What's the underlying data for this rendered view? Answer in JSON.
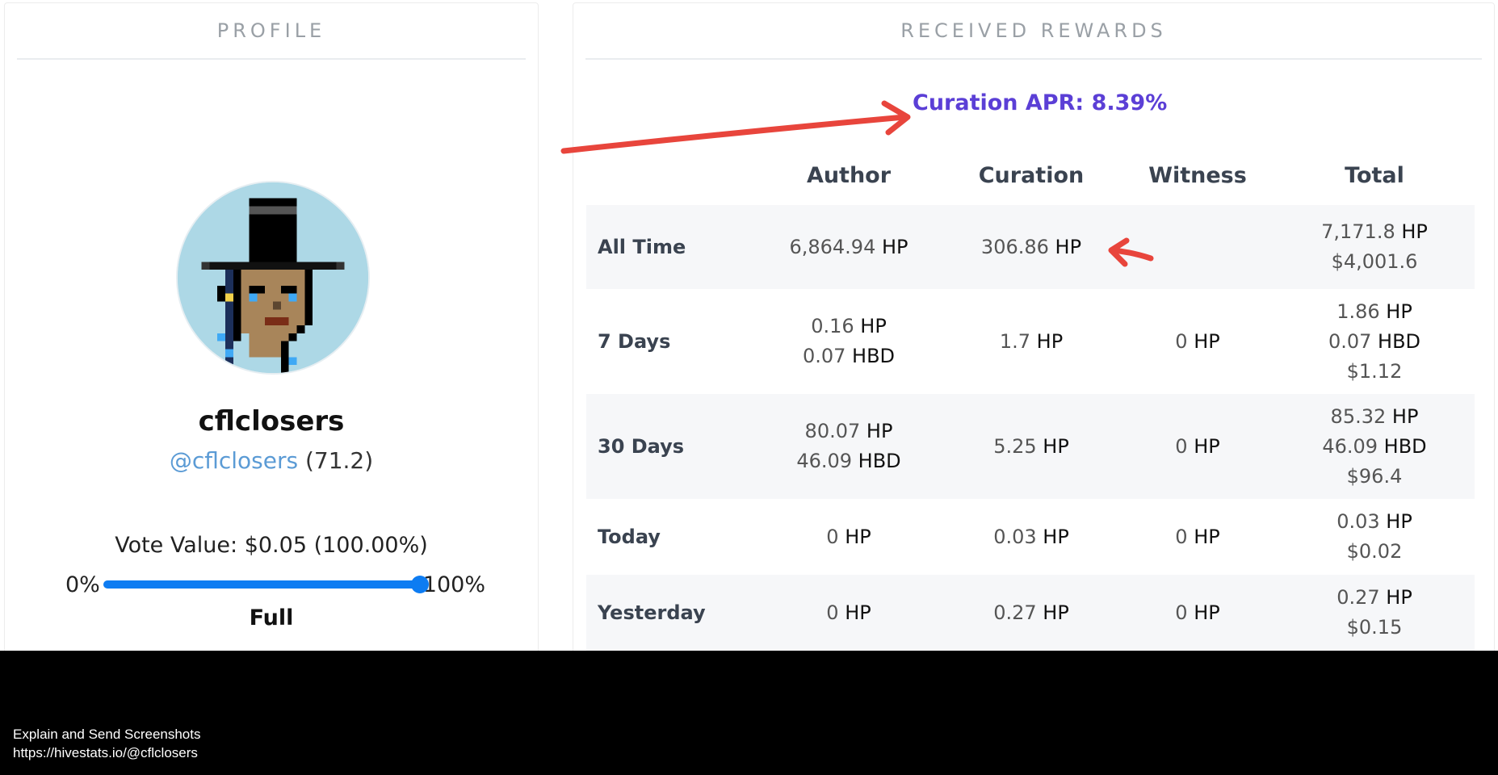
{
  "profile": {
    "header": "PROFILE",
    "username": "cflclosers",
    "handle": "@cflclosers",
    "reputation": "(71.2)",
    "vote_value": "Vote Value: $0.05 (100.00%)",
    "slider": {
      "min_label": "0%",
      "max_label": "100%",
      "level": 1.0
    },
    "vote_state": "Full"
  },
  "rewards": {
    "header": "RECEIVED REWARDS",
    "apr": "Curation APR: 8.39%",
    "columns": [
      "",
      "Author",
      "Curation",
      "Witness",
      "Total"
    ],
    "rows": [
      {
        "label": "All Time",
        "author": [
          {
            "v": "6,864.94",
            "u": "HP"
          }
        ],
        "curation": [
          {
            "v": "306.86",
            "u": "HP"
          }
        ],
        "witness": [],
        "total": [
          {
            "v": "7,171.8",
            "u": "HP"
          },
          {
            "v": "$4,001.6",
            "u": ""
          }
        ]
      },
      {
        "label": "7 Days",
        "author": [
          {
            "v": "0.16",
            "u": "HP"
          },
          {
            "v": "0.07",
            "u": "HBD"
          }
        ],
        "curation": [
          {
            "v": "1.7",
            "u": "HP"
          }
        ],
        "witness": [
          {
            "v": "0",
            "u": "HP"
          }
        ],
        "total": [
          {
            "v": "1.86",
            "u": "HP"
          },
          {
            "v": "0.07",
            "u": "HBD"
          },
          {
            "v": "$1.12",
            "u": ""
          }
        ]
      },
      {
        "label": "30 Days",
        "author": [
          {
            "v": "80.07",
            "u": "HP"
          },
          {
            "v": "46.09",
            "u": "HBD"
          }
        ],
        "curation": [
          {
            "v": "5.25",
            "u": "HP"
          }
        ],
        "witness": [
          {
            "v": "0",
            "u": "HP"
          }
        ],
        "total": [
          {
            "v": "85.32",
            "u": "HP"
          },
          {
            "v": "46.09",
            "u": "HBD"
          },
          {
            "v": "$96.4",
            "u": ""
          }
        ]
      },
      {
        "label": "Today",
        "author": [
          {
            "v": "0",
            "u": "HP"
          }
        ],
        "curation": [
          {
            "v": "0.03",
            "u": "HP"
          }
        ],
        "witness": [
          {
            "v": "0",
            "u": "HP"
          }
        ],
        "total": [
          {
            "v": "0.03",
            "u": "HP"
          },
          {
            "v": "$0.02",
            "u": ""
          }
        ]
      },
      {
        "label": "Yesterday",
        "author": [
          {
            "v": "0",
            "u": "HP"
          }
        ],
        "curation": [
          {
            "v": "0.27",
            "u": "HP"
          }
        ],
        "witness": [
          {
            "v": "0",
            "u": "HP"
          }
        ],
        "total": [
          {
            "v": "0.27",
            "u": "HP"
          },
          {
            "v": "$0.15",
            "u": ""
          }
        ]
      }
    ]
  },
  "annotations": {
    "arrow_color": "#e8453c"
  },
  "footer": {
    "line1": "Explain and Send Screenshots",
    "line2": "https://hivestats.io/@cflclosers"
  },
  "colors": {
    "accent_blue": "#0d7cf2",
    "apr_purple": "#5b3fd6",
    "link_blue": "#5b9bd5",
    "row_shade": "#f6f7f9"
  }
}
